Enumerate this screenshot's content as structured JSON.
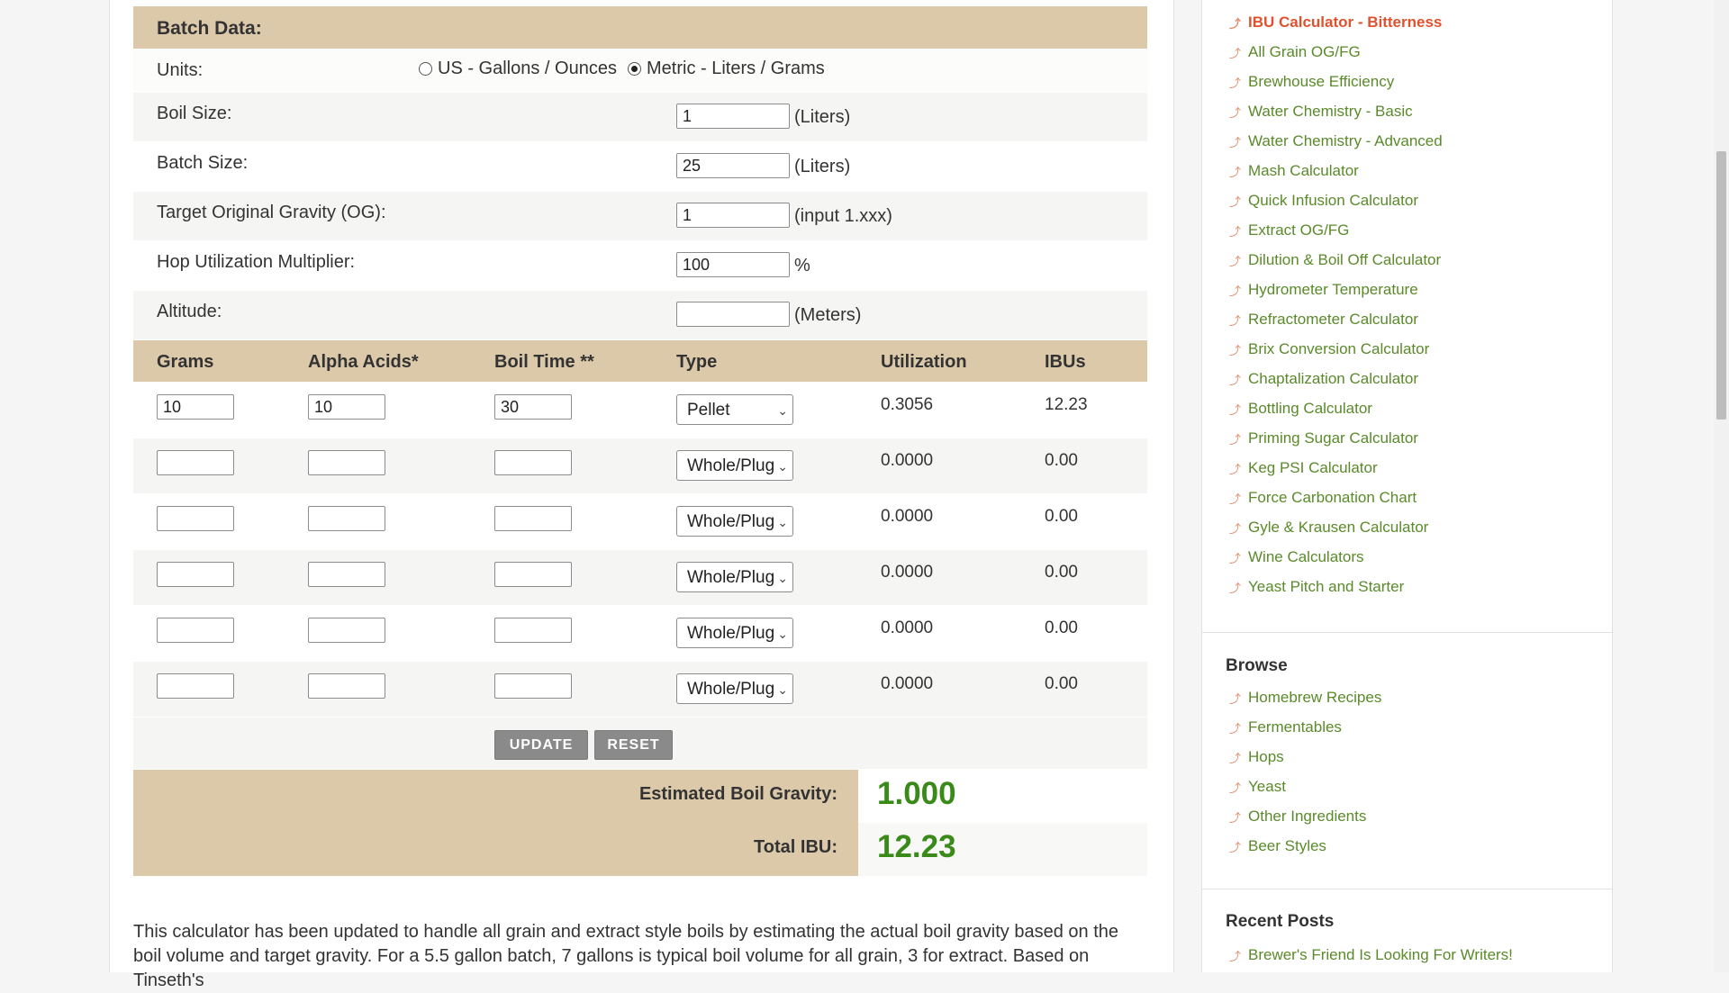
{
  "calculator": {
    "batch_header": "Batch Data:",
    "units": {
      "label": "Units:",
      "option_us": "US - Gallons / Ounces",
      "option_metric": "Metric - Liters / Grams",
      "selected": "metric"
    },
    "boil_size": {
      "label": "Boil Size:",
      "value": "1",
      "unit": "(Liters)"
    },
    "batch_size": {
      "label": "Batch Size:",
      "value": "25",
      "unit": "(Liters)"
    },
    "target_og": {
      "label": "Target Original Gravity (OG):",
      "value": "1",
      "unit": "(input 1.xxx)"
    },
    "hop_util": {
      "label": "Hop Utilization Multiplier:",
      "value": "100",
      "unit": "%"
    },
    "altitude": {
      "label": "Altitude:",
      "value": "",
      "unit": "(Meters)"
    },
    "columns": {
      "grams": "Grams",
      "alpha": "Alpha Acids*",
      "boil_time": "Boil Time **",
      "type": "Type",
      "utilization": "Utilization",
      "ibus": "IBUs"
    },
    "hops": [
      {
        "grams": "10",
        "alpha": "10",
        "time": "30",
        "type": "Pellet",
        "utilization": "0.3056",
        "ibus": "12.23"
      },
      {
        "grams": "",
        "alpha": "",
        "time": "",
        "type": "Whole/Plug",
        "utilization": "0.0000",
        "ibus": "0.00"
      },
      {
        "grams": "",
        "alpha": "",
        "time": "",
        "type": "Whole/Plug",
        "utilization": "0.0000",
        "ibus": "0.00"
      },
      {
        "grams": "",
        "alpha": "",
        "time": "",
        "type": "Whole/Plug",
        "utilization": "0.0000",
        "ibus": "0.00"
      },
      {
        "grams": "",
        "alpha": "",
        "time": "",
        "type": "Whole/Plug",
        "utilization": "0.0000",
        "ibus": "0.00"
      },
      {
        "grams": "",
        "alpha": "",
        "time": "",
        "type": "Whole/Plug",
        "utilization": "0.0000",
        "ibus": "0.00"
      }
    ],
    "update_label": "UPDATE",
    "reset_label": "RESET",
    "boil_gravity_label": "Estimated Boil Gravity:",
    "boil_gravity_value": "1.000",
    "total_ibu_label": "Total IBU:",
    "total_ibu_value": "12.23",
    "description": "This calculator has been updated to handle all grain and extract style boils by estimating the actual boil gravity based on the boil volume and target gravity. For a 5.5 gallon batch, 7 gallons is typical boil volume for all grain, 3 for extract. Based on Tinseth's"
  },
  "sidebar": {
    "tools": [
      "IBU Calculator - Bitterness",
      "All Grain OG/FG",
      "Brewhouse Efficiency",
      "Water Chemistry - Basic",
      "Water Chemistry - Advanced",
      "Mash Calculator",
      "Quick Infusion Calculator",
      "Extract OG/FG",
      "Dilution & Boil Off Calculator",
      "Hydrometer Temperature",
      "Refractometer Calculator",
      "Brix Conversion Calculator",
      "Chaptalization Calculator",
      "Bottling Calculator",
      "Priming Sugar Calculator",
      "Keg PSI Calculator",
      "Force Carbonation Chart",
      "Gyle & Krausen Calculator",
      "Wine Calculators",
      "Yeast Pitch and Starter"
    ],
    "browse_title": "Browse",
    "browse": [
      "Homebrew Recipes",
      "Fermentables",
      "Hops",
      "Yeast",
      "Other Ingredients",
      "Beer Styles"
    ],
    "recent_title": "Recent Posts",
    "recent": [
      "Brewer's Friend Is Looking For Writers!"
    ]
  },
  "colors": {
    "header_bg": "#dcc9a9",
    "link_green": "#5a8a2a",
    "active_link": "#e0522e",
    "result_green": "#3a8a1a"
  }
}
